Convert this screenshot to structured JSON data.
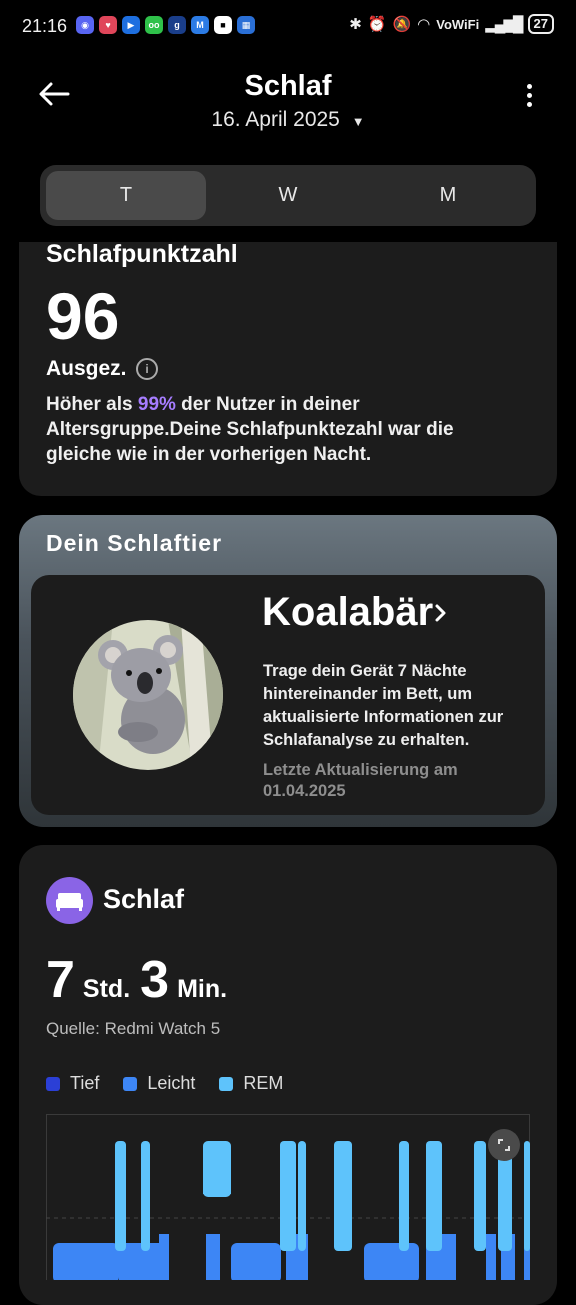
{
  "status_bar": {
    "time": "21:16",
    "network": "VoWiFi",
    "battery": "27"
  },
  "header": {
    "title": "Schlaf",
    "date": "16. April 2025"
  },
  "tabs": [
    {
      "label": "T",
      "active": true
    },
    {
      "label": "W",
      "active": false
    },
    {
      "label": "M",
      "active": false
    }
  ],
  "score": {
    "title": "Schlafpunktzahl",
    "value": "96",
    "grade": "Ausgez.",
    "desc_prefix": "Höher als ",
    "percent": "99%",
    "desc_suffix": " der Nutzer in deiner Altersgruppe.Deine Schlafpunktezahl war die gleiche wie in der vorherigen Nacht."
  },
  "animal": {
    "heading": "Dein Schlaftier",
    "name": "Koalabär",
    "description": "Trage dein Gerät 7 Nächte hintereinander im Bett, um aktualisierte Informationen zur Schlafanalyse zu erhalten.",
    "updated": "Letzte Aktualisierung am 01.04.2025"
  },
  "sleep": {
    "title": "Schlaf",
    "hours": "7",
    "hours_unit": "Std.",
    "minutes": "3",
    "minutes_unit": "Min.",
    "source": "Quelle: Redmi Watch 5",
    "legend": [
      {
        "label": "Tief",
        "color": "#2b3fd6"
      },
      {
        "label": "Leicht",
        "color": "#3d86f5"
      },
      {
        "label": "REM",
        "color": "#5ec3fb"
      }
    ]
  },
  "colors": {
    "accent_purple": "#a67dff",
    "icon_purple": "#8a64e6"
  }
}
